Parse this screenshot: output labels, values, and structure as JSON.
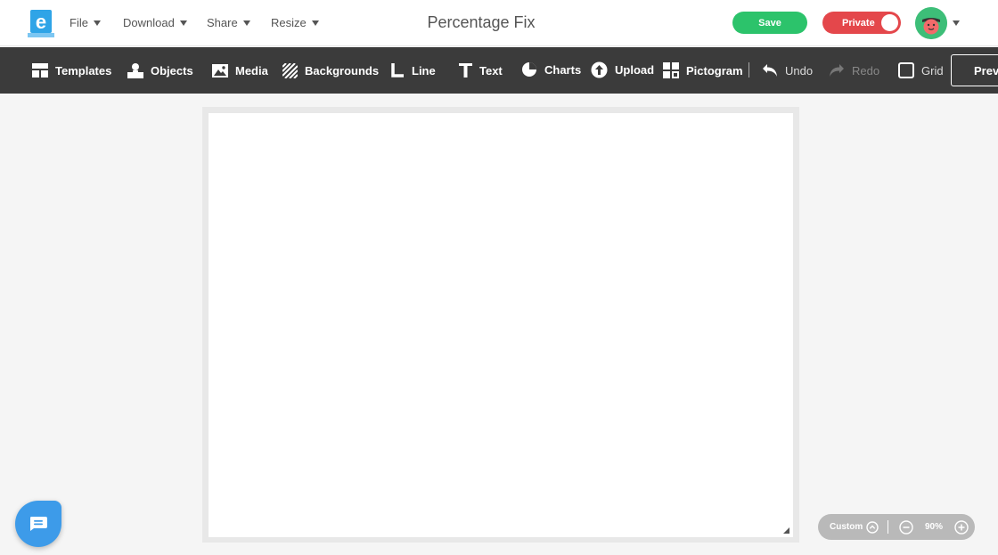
{
  "header": {
    "menus": [
      "File",
      "Download",
      "Share",
      "Resize"
    ],
    "document_title": "Percentage Fix",
    "save_label": "Save",
    "privacy_label": "Private"
  },
  "toolbar": {
    "templates": "Templates",
    "objects": "Objects",
    "media": "Media",
    "backgrounds": "Backgrounds",
    "line": "Line",
    "text": "Text",
    "charts": "Charts",
    "upload": "Upload",
    "pictogram": "Pictogram",
    "undo": "Undo",
    "redo": "Redo",
    "grid": "Grid",
    "preview": "Previ"
  },
  "zoom": {
    "preset_label": "Custom",
    "level": "90%"
  },
  "colors": {
    "save": "#2cc36b",
    "private": "#e4474b",
    "toolbar_bg": "#3b3b3b",
    "logo": "#2fa4e7",
    "chat": "#3d9be9"
  }
}
